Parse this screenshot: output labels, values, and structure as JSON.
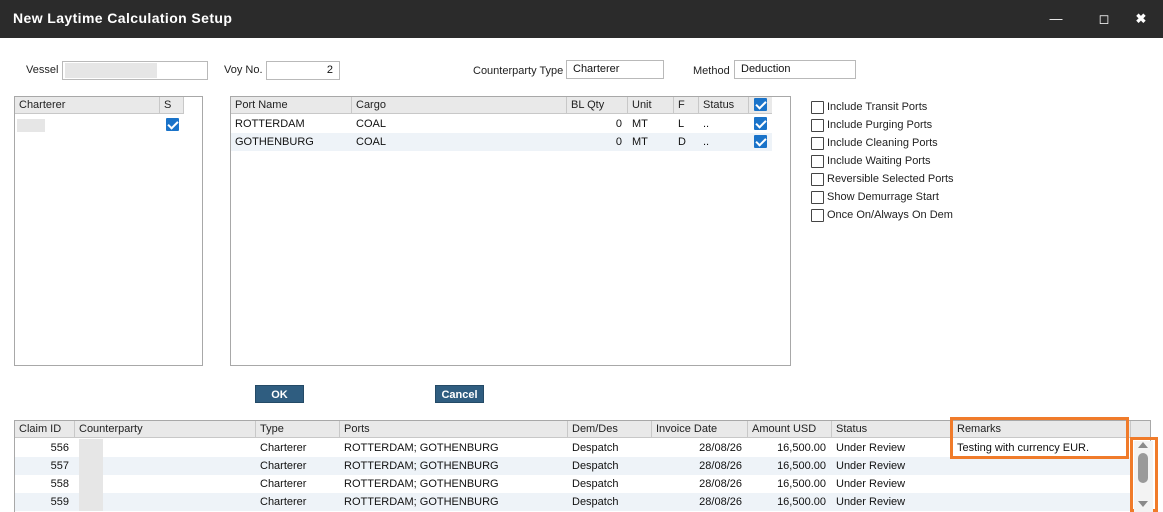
{
  "window": {
    "title": "New Laytime Calculation Setup",
    "min_icon": "minimize-icon",
    "max_icon": "maximize-icon",
    "close_icon": "close-icon"
  },
  "form": {
    "vessel_label": "Vessel",
    "vessel_value": "",
    "voy_label": "Voy No.",
    "voy_value": "2",
    "counterparty_type_label": "Counterparty Type",
    "counterparty_type_value": "Charterer",
    "method_label": "Method",
    "method_value": "Deduction"
  },
  "charterer_grid": {
    "headers": [
      "Charterer",
      "S"
    ],
    "rows": [
      {
        "name": "",
        "selected": true
      }
    ]
  },
  "ports_grid": {
    "headers": [
      "Port Name",
      "Cargo",
      "BL Qty",
      "Unit",
      "F",
      "Status"
    ],
    "header_checked": true,
    "rows": [
      {
        "port": "ROTTERDAM",
        "cargo": "COAL",
        "bl_qty": "0",
        "unit": "MT",
        "f": "L",
        "status": "..",
        "checked": true
      },
      {
        "port": "GOTHENBURG",
        "cargo": "COAL",
        "bl_qty": "0",
        "unit": "MT",
        "f": "D",
        "status": "..",
        "checked": true
      }
    ]
  },
  "options": [
    {
      "label": "Include Transit Ports",
      "checked": false
    },
    {
      "label": "Include Purging Ports",
      "checked": false
    },
    {
      "label": "Include Cleaning Ports",
      "checked": false
    },
    {
      "label": "Include Waiting Ports",
      "checked": false
    },
    {
      "label": "Reversible Selected Ports",
      "checked": false
    },
    {
      "label": "Show Demurrage Start",
      "checked": false
    },
    {
      "label": "Once On/Always On Dem",
      "checked": false
    }
  ],
  "buttons": {
    "ok": "OK",
    "cancel": "Cancel"
  },
  "claims_grid": {
    "headers": [
      "Claim ID",
      "Counterparty",
      "Type",
      "Ports",
      "Dem/Des",
      "Invoice Date",
      "Amount USD",
      "Status",
      "Remarks"
    ],
    "rows": [
      {
        "id": "556",
        "counterparty": "",
        "type": "Charterer",
        "ports": "ROTTERDAM; GOTHENBURG",
        "demdes": "Despatch",
        "date": "28/08/26",
        "amount": "16,500.00",
        "status": "Under Review",
        "remarks": "Testing with currency EUR."
      },
      {
        "id": "557",
        "counterparty": "",
        "type": "Charterer",
        "ports": "ROTTERDAM; GOTHENBURG",
        "demdes": "Despatch",
        "date": "28/08/26",
        "amount": "16,500.00",
        "status": "Under Review",
        "remarks": ""
      },
      {
        "id": "558",
        "counterparty": "",
        "type": "Charterer",
        "ports": "ROTTERDAM; GOTHENBURG",
        "demdes": "Despatch",
        "date": "28/08/26",
        "amount": "16,500.00",
        "status": "Under Review",
        "remarks": ""
      },
      {
        "id": "559",
        "counterparty": "",
        "type": "Charterer",
        "ports": "ROTTERDAM; GOTHENBURG",
        "demdes": "Despatch",
        "date": "28/08/26",
        "amount": "16,500.00",
        "status": "Under Review",
        "remarks": ""
      }
    ]
  },
  "colors": {
    "titlebar": "#2b2b2b",
    "button": "#2f5d80",
    "checkbox": "#1a73c9",
    "highlight": "#f07b2a"
  }
}
